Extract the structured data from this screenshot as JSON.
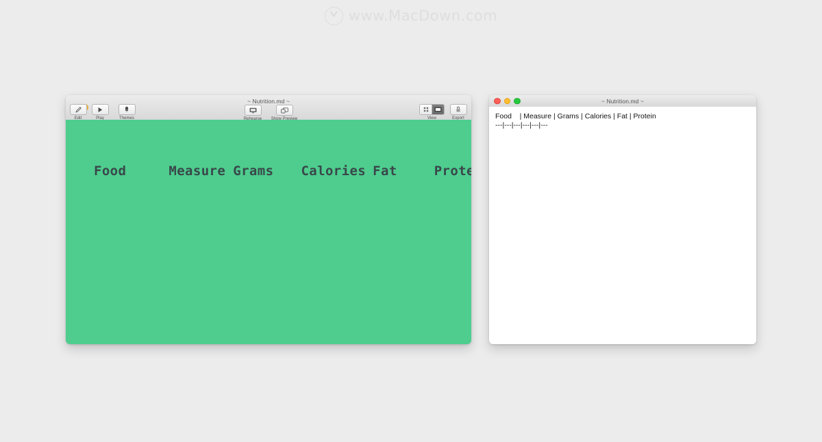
{
  "watermark": {
    "logo_icon": "macdown-circle-logo-icon",
    "text": "www.MacDown.com"
  },
  "colors": {
    "page_background": "#ececec",
    "slide_green": "#4ecd8e",
    "slide_text": "#39474a",
    "titlebar_top": "#ececec",
    "titlebar_bottom": "#d8d8d8",
    "editor_background": "#ffffff",
    "traffic_red": "#ff5f57",
    "traffic_yellow": "#ffbd2e",
    "traffic_green": "#28c840"
  },
  "deck_window": {
    "title": "~ Nutrition.md ~",
    "traffic_lights": [
      "close",
      "minimize",
      "zoom"
    ],
    "toolbar": {
      "left_items": [
        {
          "label": "Edit",
          "icon": "pencil-icon"
        },
        {
          "label": "Play",
          "icon": "play-triangle-icon"
        },
        {
          "label": "Themes",
          "icon": "paintbrush-icon"
        }
      ],
      "center_items": [
        {
          "label": "Rehearse",
          "icon": "display-screen-icon"
        },
        {
          "label": "Show Preview",
          "icon": "overlapping-windows-icon"
        }
      ],
      "right_items": [
        {
          "label": "View",
          "icon": "view-segmented-icon",
          "segments": [
            "grid-view-icon",
            "presentation-view-icon"
          ],
          "selected_segment": 1
        },
        {
          "label": "Export",
          "icon": "export-lock-icon"
        }
      ]
    },
    "slide": {
      "columns": [
        "Food",
        "Measure",
        "Grams",
        "Calories",
        "Fat",
        "Protein"
      ]
    }
  },
  "editor_window": {
    "title": "~ Nutrition.md ~",
    "traffic_lights": [
      "close",
      "minimize",
      "zoom"
    ],
    "markdown_lines": [
      "Food    | Measure | Grams | Calories | Fat | Protein",
      "---|---|---|---|---|---"
    ]
  }
}
